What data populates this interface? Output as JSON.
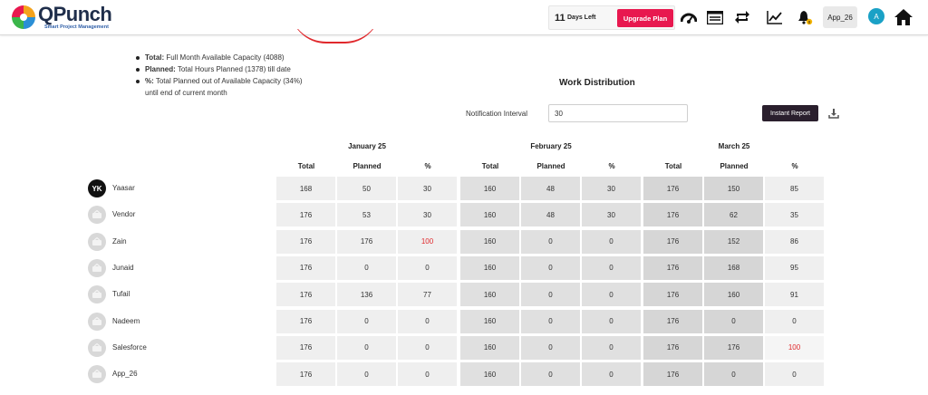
{
  "header": {
    "logo_text": "QPunch",
    "logo_sub": "Smart Project Management",
    "days_num": "11",
    "days_text": "Days Left",
    "upgrade_label": "Upgrade Plan",
    "icons": [
      "dashboard-icon",
      "list-icon",
      "sync-icon",
      "chart-icon",
      "bell-icon",
      "home-icon"
    ],
    "app_label": "App_26",
    "avatar_letter": "A",
    "notification_count": "0"
  },
  "notes": {
    "total_label": "Total:",
    "total_text": "Full Month Available Capacity (4088)",
    "planned_label": "Planned:",
    "planned_text": "Total Hours Planned (1378) till date",
    "pct_label": "%:",
    "pct_text": "Total Planned out of Available Capacity (34%)",
    "pct_cont": "until end of current month"
  },
  "title": "Work Distribution",
  "notification": {
    "label": "Notification Interval",
    "value": "30"
  },
  "instant_report_label": "Instant Report",
  "months": [
    "January 25",
    "February 25",
    "March 25"
  ],
  "columns": [
    "Total",
    "Planned",
    "%"
  ],
  "colors": {
    "accent": "#e8184f",
    "danger": "#e0282c",
    "dark_button": "#2a1f2d"
  },
  "rows": [
    {
      "name": "Yaasar",
      "initials": "YK",
      "values": [
        "168",
        "50",
        "30",
        "160",
        "48",
        "30",
        "176",
        "150",
        "85"
      ]
    },
    {
      "name": "Vendor",
      "initials": "",
      "values": [
        "176",
        "53",
        "30",
        "160",
        "48",
        "30",
        "176",
        "62",
        "35"
      ]
    },
    {
      "name": "Zain",
      "initials": "",
      "values": [
        "176",
        "176",
        "100",
        "160",
        "0",
        "0",
        "176",
        "152",
        "86"
      ]
    },
    {
      "name": "Junaid",
      "initials": "",
      "values": [
        "176",
        "0",
        "0",
        "160",
        "0",
        "0",
        "176",
        "168",
        "95"
      ]
    },
    {
      "name": "Tufail",
      "initials": "",
      "values": [
        "176",
        "136",
        "77",
        "160",
        "0",
        "0",
        "176",
        "160",
        "91"
      ]
    },
    {
      "name": "Nadeem",
      "initials": "",
      "values": [
        "176",
        "0",
        "0",
        "160",
        "0",
        "0",
        "176",
        "0",
        "0"
      ]
    },
    {
      "name": "Salesforce",
      "initials": "",
      "values": [
        "176",
        "0",
        "0",
        "160",
        "0",
        "0",
        "176",
        "176",
        "100"
      ]
    },
    {
      "name": "App_26",
      "initials": "",
      "values": [
        "176",
        "0",
        "0",
        "160",
        "0",
        "0",
        "176",
        "0",
        "0"
      ]
    }
  ]
}
